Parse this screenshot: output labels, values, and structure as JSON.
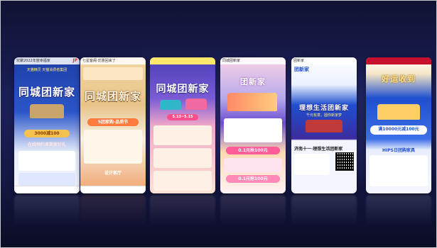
{
  "phones": [
    {
      "status": "欢聚2022年度幸福家",
      "badge": "JP",
      "subtitle": "天猫精灵 天猫消费者集团",
      "title": "同城团新家",
      "amount": "3000减100",
      "banner": "在线预约享新家好礼"
    },
    {
      "status": "七星客阁·优惠回来了",
      "title": "同城团新家",
      "banner": "5团家购·品质节",
      "section": "设计客厅"
    },
    {
      "status": "",
      "title": "同城团新家",
      "banner": "5.13~5.15"
    },
    {
      "status": "同城团新家",
      "logo": "团新家",
      "title": "团新家",
      "banner": "0.1元抢100元",
      "banner2": "0.1元抢100元"
    },
    {
      "status": "团新家",
      "logo": "团新家",
      "title": "理想生活团新家",
      "subtitle": "千元有意，圆你新家梦",
      "store": "济南十一·理想生活团新家"
    },
    {
      "status": "",
      "title": "好运收到",
      "amount": "满10000元减100元",
      "banner": "HIPS日团购家具"
    }
  ],
  "colors": {
    "bg_dark": "#101233",
    "pink": "#f06aa0",
    "gold": "#f2c14e",
    "orange": "#ff7a3d",
    "teal": "#2fb6c8"
  }
}
